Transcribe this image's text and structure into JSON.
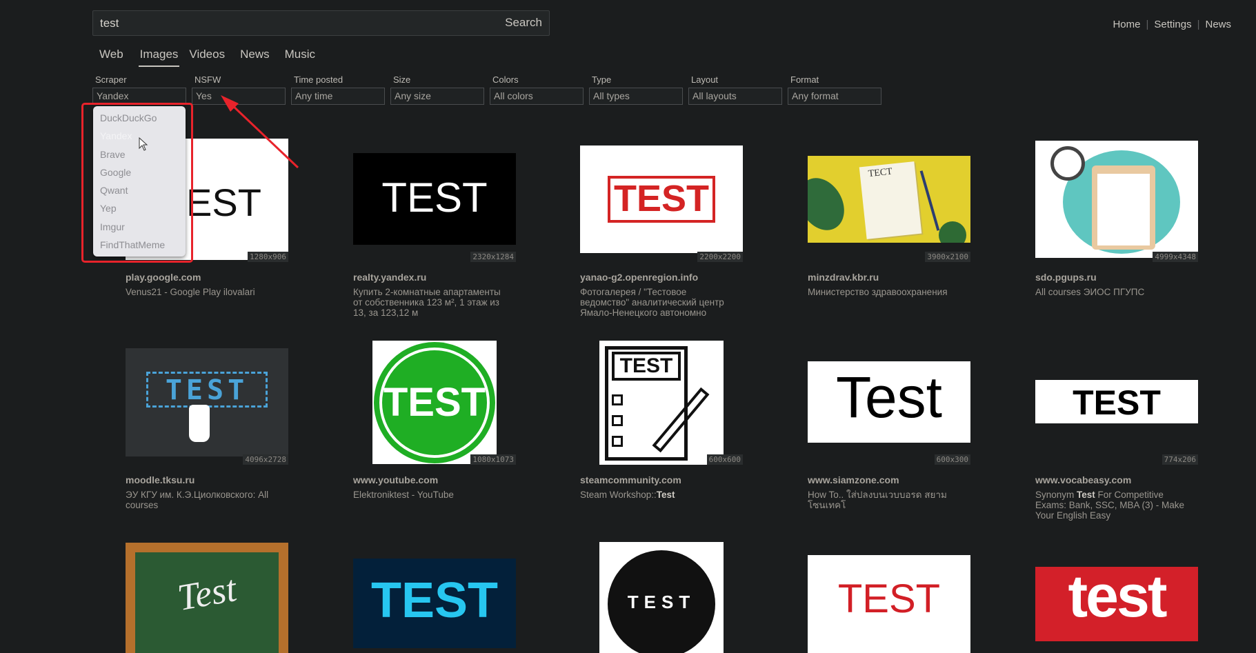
{
  "search": {
    "query": "test",
    "button_label": "Search"
  },
  "top_links": [
    "Home",
    "Settings",
    "News"
  ],
  "tabs": [
    {
      "label": "Web",
      "active": false
    },
    {
      "label": "Images",
      "active": true
    },
    {
      "label": "Videos",
      "active": false
    },
    {
      "label": "News",
      "active": false
    },
    {
      "label": "Music",
      "active": false
    }
  ],
  "filters": [
    {
      "label": "Scraper",
      "value": "Yandex"
    },
    {
      "label": "NSFW",
      "value": "Yes"
    },
    {
      "label": "Time posted",
      "value": "Any time"
    },
    {
      "label": "Size",
      "value": "Any size"
    },
    {
      "label": "Colors",
      "value": "All colors"
    },
    {
      "label": "Type",
      "value": "All types"
    },
    {
      "label": "Layout",
      "value": "All layouts"
    },
    {
      "label": "Format",
      "value": "Any format"
    }
  ],
  "scraper_dropdown": {
    "options": [
      "DuckDuckGo",
      "Yandex",
      "Brave",
      "Google",
      "Qwant",
      "Yep",
      "Imgur",
      "FindThatMeme"
    ],
    "selected": "Yandex"
  },
  "annotation_color": "#e8232b",
  "results": [
    {
      "domain": "play.google.com",
      "title": "Venus21 - Google Play ilovalari",
      "dims": "1280x906",
      "thumb_text": "EST"
    },
    {
      "domain": "realty.yandex.ru",
      "title": "Купить 2-комнатные апартаменты от собственника 123 м², 1 этаж из 13, за 123,12 м",
      "dims": "2320x1284",
      "thumb_text": "TEST"
    },
    {
      "domain": "yanao-g2.openregion.info",
      "title": "Фотогалерея / \"Тестовое ведомство\" аналитический центр Ямало-Ненецкого автономно",
      "dims": "2200x2200",
      "thumb_text": "TEST"
    },
    {
      "domain": "minzdrav.kbr.ru",
      "title": "Министерство здравоохранения",
      "dims": "3900x2100",
      "thumb_text": "ТЕСТ"
    },
    {
      "domain": "sdo.pgups.ru",
      "title": "All courses ЭИОС ПГУПС",
      "dims": "4999x4348",
      "thumb_text": ""
    },
    {
      "domain": "moodle.tksu.ru",
      "title": "ЭУ КГУ им. К.Э.Циолковского: All courses",
      "dims": "4096x2728",
      "thumb_text": "TEST"
    },
    {
      "domain": "www.youtube.com",
      "title": "Elektroniktest - YouTube",
      "dims": "1080x1073",
      "thumb_text": "TEST"
    },
    {
      "domain": "steamcommunity.com",
      "title_prefix": "Steam Workshop::",
      "title_bold": "Test",
      "dims": "600x600",
      "thumb_text": "TEST"
    },
    {
      "domain": "www.siamzone.com",
      "title": "How To.. ใส่ปลงบนเวบบอรด สยามโซนเทคโ",
      "dims": "600x300",
      "thumb_text": "Test"
    },
    {
      "domain": "www.vocabeasy.com",
      "title_prefix": "Synonym ",
      "title_bold": "Test",
      "title_suffix": " For Competitive Exams: Bank, SSC, MBA (3) - Make Your English Easy",
      "dims": "774x206",
      "thumb_text": "TEST"
    },
    {
      "thumb_text": "Test"
    },
    {
      "thumb_text": "TEST"
    },
    {
      "thumb_text": "TEST"
    },
    {
      "thumb_text": "TEST"
    },
    {
      "thumb_text": "test"
    }
  ]
}
